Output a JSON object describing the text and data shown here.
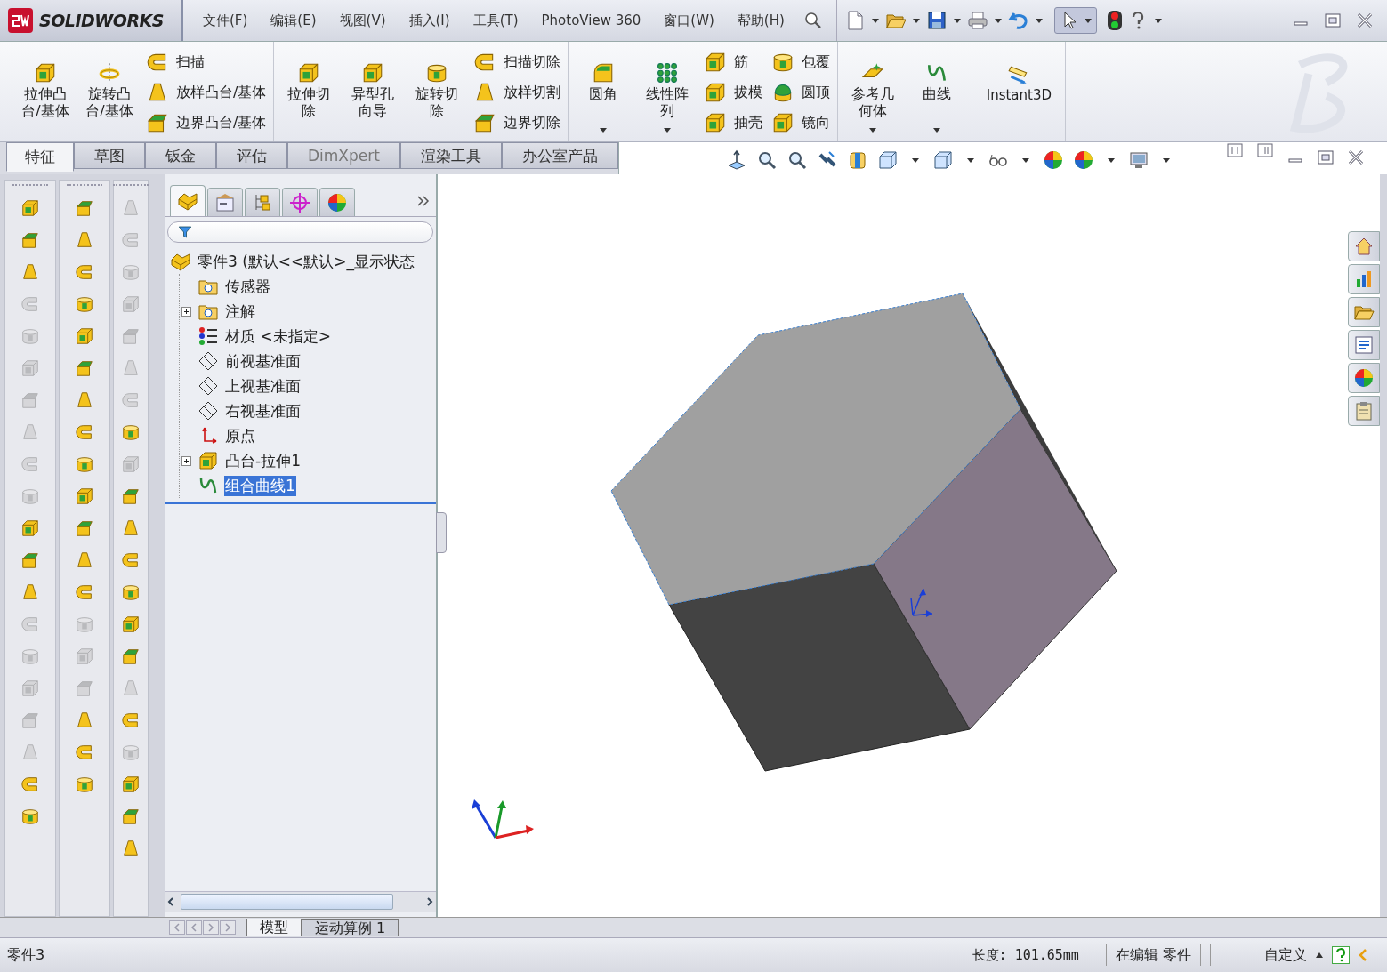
{
  "title_bar": {
    "logo": "SOLIDWORKS",
    "menus": [
      "文件(F)",
      "编辑(E)",
      "视图(V)",
      "插入(I)",
      "工具(T)",
      "PhotoView 360",
      "窗口(W)",
      "帮助(H)"
    ],
    "select_tool": {
      "selected": true
    }
  },
  "ribbon": {
    "groups": [
      {
        "columns": [
          {
            "items": [
              {
                "kind": "large",
                "label": "拉伸凸台/基体",
                "dropdown": false
              }
            ]
          },
          {
            "items": [
              {
                "kind": "large",
                "label": "旋转凸台/基体",
                "dropdown": false
              }
            ]
          },
          {
            "items": [
              {
                "kind": "small",
                "label": "扫描"
              },
              {
                "kind": "small",
                "label": "放样凸台/基体"
              },
              {
                "kind": "small",
                "label": "边界凸台/基体"
              }
            ]
          }
        ]
      },
      {
        "columns": [
          {
            "items": [
              {
                "kind": "large",
                "label": "拉伸切除",
                "dropdown": false
              }
            ]
          },
          {
            "items": [
              {
                "kind": "large",
                "label": "异型孔向导",
                "dropdown": false
              }
            ]
          },
          {
            "items": [
              {
                "kind": "large",
                "label": "旋转切除",
                "dropdown": false
              }
            ]
          },
          {
            "items": [
              {
                "kind": "small",
                "label": "扫描切除"
              },
              {
                "kind": "small",
                "label": "放样切割"
              },
              {
                "kind": "small",
                "label": "边界切除"
              }
            ]
          }
        ]
      },
      {
        "columns": [
          {
            "items": [
              {
                "kind": "large",
                "label": "圆角",
                "dropdown": true
              }
            ]
          },
          {
            "items": [
              {
                "kind": "large",
                "label": "线性阵列",
                "dropdown": true
              }
            ]
          },
          {
            "items": [
              {
                "kind": "small",
                "label": "筋"
              },
              {
                "kind": "small",
                "label": "拔模"
              },
              {
                "kind": "small",
                "label": "抽壳"
              }
            ]
          },
          {
            "items": [
              {
                "kind": "small",
                "label": "包覆"
              },
              {
                "kind": "small",
                "label": "圆顶"
              },
              {
                "kind": "small",
                "label": "镜向"
              }
            ]
          }
        ]
      },
      {
        "columns": [
          {
            "items": [
              {
                "kind": "large",
                "label": "参考几何体",
                "dropdown": true
              }
            ]
          },
          {
            "items": [
              {
                "kind": "large",
                "label": "曲线",
                "dropdown": true
              }
            ]
          }
        ]
      },
      {
        "columns": [
          {
            "items": [
              {
                "kind": "toggle",
                "label": "Instant3D",
                "dropdown": false
              }
            ]
          }
        ]
      }
    ]
  },
  "command_tabs": [
    {
      "label": "特征",
      "selected": true,
      "disabled": false
    },
    {
      "label": "草图",
      "selected": false,
      "disabled": false
    },
    {
      "label": "钣金",
      "selected": false,
      "disabled": false
    },
    {
      "label": "评估",
      "selected": false,
      "disabled": false
    },
    {
      "label": "DimXpert",
      "selected": false,
      "disabled": true
    },
    {
      "label": "渲染工具",
      "selected": false,
      "disabled": false
    },
    {
      "label": "办公室产品",
      "selected": false,
      "disabled": false
    }
  ],
  "toolbars": [
    {
      "buttons": [
        {
          "disabled": false
        },
        {
          "disabled": false
        },
        {
          "disabled": false
        },
        {
          "disabled": true
        },
        {
          "disabled": true
        },
        {
          "disabled": true
        },
        {
          "disabled": true
        },
        {
          "disabled": true
        },
        {
          "disabled": true
        },
        {
          "disabled": true
        },
        {
          "disabled": false
        },
        {
          "disabled": false
        },
        {
          "disabled": false
        },
        {
          "disabled": true
        },
        {
          "disabled": true
        },
        {
          "disabled": true
        },
        {
          "disabled": true
        },
        {
          "disabled": true
        },
        {
          "disabled": false
        },
        {
          "disabled": false
        }
      ]
    },
    {
      "buttons": [
        {
          "disabled": false
        },
        {
          "disabled": false
        },
        {
          "disabled": false
        },
        {
          "disabled": false
        },
        {
          "disabled": false
        },
        {
          "disabled": false
        },
        {
          "disabled": false
        },
        {
          "disabled": false
        },
        {
          "disabled": false
        },
        {
          "disabled": false
        },
        {
          "disabled": false
        },
        {
          "disabled": false
        },
        {
          "disabled": false
        },
        {
          "disabled": true
        },
        {
          "disabled": true
        },
        {
          "disabled": true
        },
        {
          "disabled": false
        },
        {
          "disabled": false
        },
        {
          "disabled": false
        }
      ]
    },
    {
      "buttons": [
        {
          "disabled": true
        },
        {
          "disabled": true
        },
        {
          "disabled": true
        },
        {
          "disabled": true
        },
        {
          "disabled": true
        },
        {
          "disabled": true
        },
        {
          "disabled": true
        },
        {
          "disabled": false
        },
        {
          "disabled": true
        },
        {
          "disabled": false
        },
        {
          "disabled": false
        },
        {
          "disabled": false
        },
        {
          "disabled": false
        },
        {
          "disabled": false
        },
        {
          "disabled": false
        },
        {
          "disabled": true
        },
        {
          "disabled": false
        },
        {
          "disabled": true
        },
        {
          "disabled": false
        },
        {
          "disabled": false
        },
        {
          "disabled": false
        }
      ]
    }
  ],
  "feature_manager": {
    "tabs": [
      {
        "selected": true
      },
      {
        "selected": false
      },
      {
        "selected": false
      },
      {
        "selected": false
      },
      {
        "selected": false
      }
    ],
    "tree": {
      "label": "零件3   (默认<<默认>_显示状态",
      "selected": false,
      "children": [
        {
          "label": "传感器",
          "collapsed": false,
          "selected": false
        },
        {
          "label": "注解",
          "collapsed": true,
          "selected": false
        },
        {
          "label": "材质 <未指定>",
          "collapsed": false,
          "selected": false
        },
        {
          "label": "前视基准面",
          "collapsed": false,
          "selected": false
        },
        {
          "label": "上视基准面",
          "collapsed": false,
          "selected": false
        },
        {
          "label": "右视基准面",
          "collapsed": false,
          "selected": false
        },
        {
          "label": "原点",
          "collapsed": false,
          "selected": false
        },
        {
          "label": "凸台-拉伸1",
          "collapsed": true,
          "selected": false
        },
        {
          "label": "组合曲线1",
          "collapsed": false,
          "selected": true
        }
      ]
    }
  },
  "sheet_tabs": [
    {
      "label": "模型",
      "selected": true
    },
    {
      "label": "运动算例 1",
      "selected": false
    }
  ],
  "status_bar": {
    "document": "零件3",
    "length": "长度: 101.65mm",
    "mode": "在编辑 零件",
    "units": "自定义"
  }
}
